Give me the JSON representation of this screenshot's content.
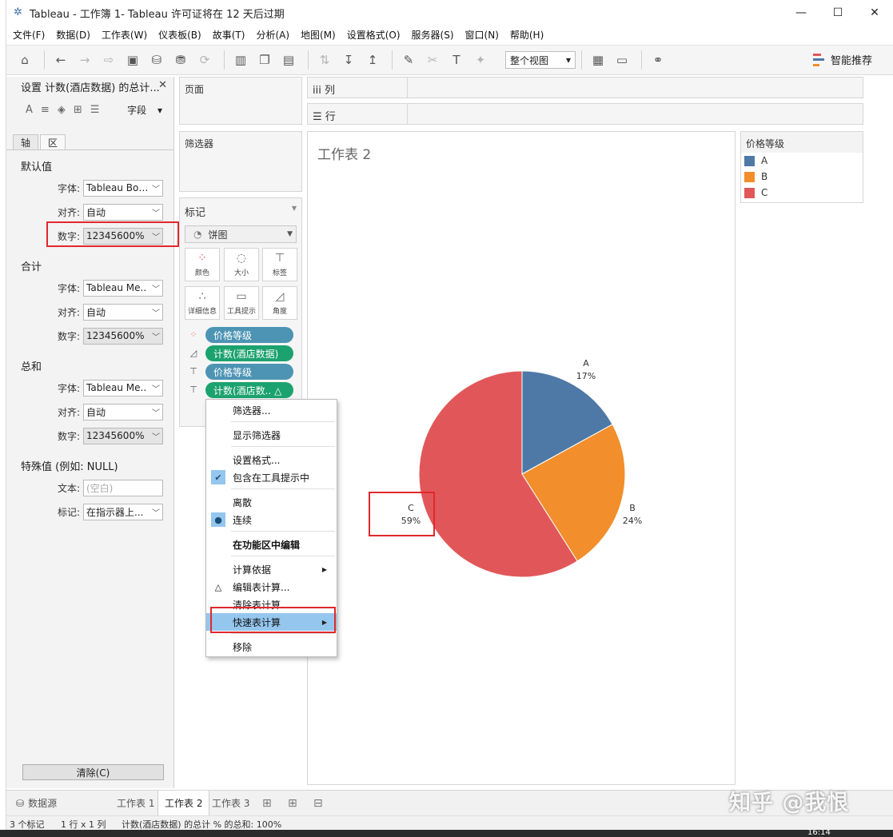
{
  "window": {
    "title": "Tableau - 工作簿 1- Tableau 许可证将在 12 天后过期",
    "minimize": "—",
    "maximize": "☐",
    "close": "✕"
  },
  "menu": [
    "文件(F)",
    "数据(D)",
    "工作表(W)",
    "仪表板(B)",
    "故事(T)",
    "分析(A)",
    "地图(M)",
    "设置格式(O)",
    "服务器(S)",
    "窗口(N)",
    "帮助(H)"
  ],
  "toolbar": {
    "view_select": "整个视图",
    "smart_recommend": "智能推荐"
  },
  "format_pane": {
    "title": "设置 计数(酒店数据) 的总计...",
    "field_label": "字段",
    "tabs": [
      "轴",
      "区"
    ],
    "sections": {
      "default": {
        "header": "默认值",
        "font_label": "字体:",
        "font_value": "Tableau Boo..",
        "align_label": "对齐:",
        "align_value": "自动",
        "number_label": "数字:",
        "number_value": "12345600%"
      },
      "total": {
        "header": "合计",
        "font_label": "字体:",
        "font_value": "Tableau Me..",
        "align_label": "对齐:",
        "align_value": "自动",
        "number_label": "数字:",
        "number_value": "12345600%"
      },
      "grand_total": {
        "header": "总和",
        "font_label": "字体:",
        "font_value": "Tableau Me..",
        "align_label": "对齐:",
        "align_value": "自动",
        "number_label": "数字:",
        "number_value": "12345600%"
      },
      "special": {
        "header": "特殊值 (例如: NULL)",
        "text_label": "文本:",
        "text_placeholder": "(空白)",
        "marks_label": "标记:",
        "marks_value": "在指示器上..."
      }
    },
    "clear_button": "清除(C)"
  },
  "shelves": {
    "pages": "页面",
    "filters": "筛选器",
    "marks": "标记",
    "columns": "列",
    "rows": "行"
  },
  "marks": {
    "type": "饼图",
    "buttons": [
      "颜色",
      "大小",
      "标签",
      "详细信息",
      "工具提示",
      "角度"
    ],
    "pills": [
      "价格等级",
      "计数(酒店数据)",
      "价格等级",
      "计数(酒店数..  △"
    ]
  },
  "context_menu": {
    "items": [
      "筛选器...",
      "显示筛选器",
      "设置格式...",
      "包含在工具提示中",
      "离散",
      "连续",
      "在功能区中编辑",
      "计算依据",
      "编辑表计算...",
      "清除表计算",
      "快速表计算",
      "移除"
    ]
  },
  "sheet": {
    "title": "工作表 2"
  },
  "legend": {
    "title": "价格等级",
    "items": [
      {
        "label": "A",
        "color": "#4e79a7"
      },
      {
        "label": "B",
        "color": "#f28e2b"
      },
      {
        "label": "C",
        "color": "#e15759"
      }
    ]
  },
  "chart_data": {
    "type": "pie",
    "categories": [
      "A",
      "B",
      "C"
    ],
    "values": [
      17,
      24,
      59
    ],
    "labels": [
      "17%",
      "24%",
      "59%"
    ],
    "colors": [
      "#4e79a7",
      "#f28e2b",
      "#e15759"
    ],
    "legend_title": "价格等级",
    "legend_position": "right"
  },
  "tabs": {
    "datasource": "数据源",
    "sheets": [
      "工作表 1",
      "工作表 2",
      "工作表 3"
    ]
  },
  "status": {
    "marks": "3 个标记",
    "dims": "1 行 x 1 列",
    "sum": "计数(酒店数据) 的总计 % 的总和: 100%",
    "time": "16:14"
  },
  "watermark": "知乎 @我恨"
}
